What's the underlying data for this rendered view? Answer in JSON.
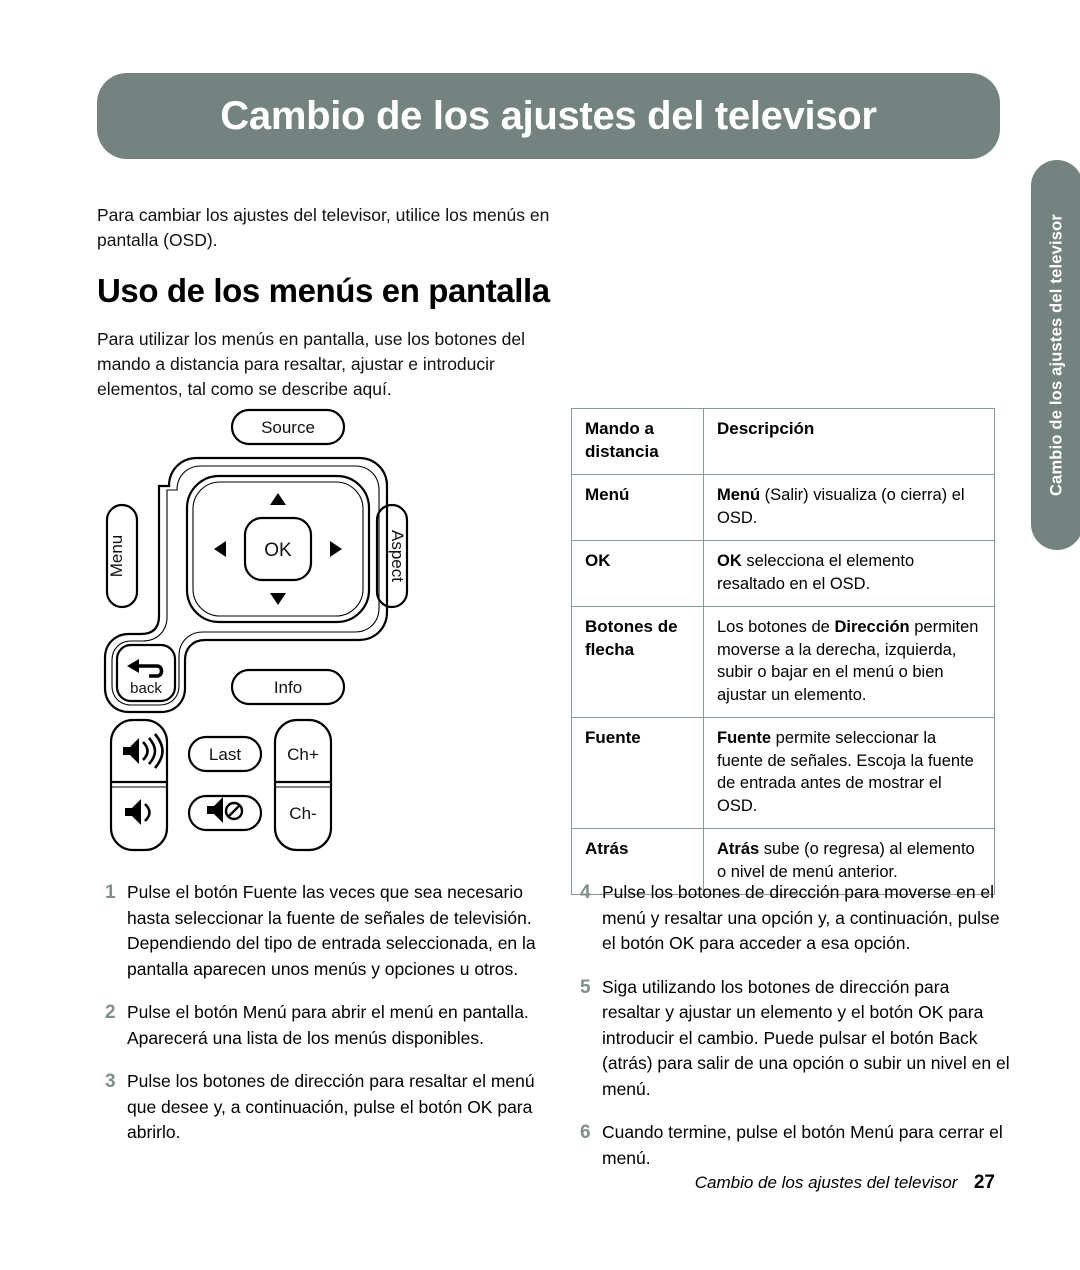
{
  "header": {
    "title": "Cambio de los ajustes del televisor"
  },
  "side_tab": {
    "label": "Cambio de los ajustes del televisor"
  },
  "intro": {
    "paragraph_1": "Para cambiar los ajustes del televisor, utilice los menús en pantalla (OSD).",
    "section_heading": "Uso de los menús en pantalla",
    "paragraph_2": "Para utilizar los menús en pantalla, use los botones del mando a distancia para resaltar, ajustar e introducir elementos, tal como se describe aquí."
  },
  "remote": {
    "source_label": "Source",
    "menu_label": "Menu",
    "aspect_label": "Aspect",
    "ok_label": "OK",
    "back_label": "back",
    "info_label": "Info",
    "last_label": "Last",
    "ch_up_label": "Ch+",
    "ch_down_label": "Ch-"
  },
  "table": {
    "headers": [
      "Mando a distancia",
      "Descripción"
    ],
    "header_key_line1": "Mando a",
    "header_key_line2": "distancia",
    "header_desc": "Descripción",
    "rows": [
      {
        "key": "Menú",
        "desc_bold": "Menú",
        "desc_rest": " (Salir) visualiza (o cierra) el OSD."
      },
      {
        "key": "OK",
        "desc_bold": "OK",
        "desc_rest": " selecciona el elemento resaltado en el OSD."
      },
      {
        "key": "Botones de flecha",
        "desc_pre": "Los botones de ",
        "desc_bold": "Dirección",
        "desc_rest": " permiten moverse a la derecha, izquierda, subir o bajar en el menú o bien ajustar un elemento."
      },
      {
        "key": "Fuente",
        "desc_bold": "Fuente",
        "desc_rest": " permite seleccionar la fuente de señales. Escoja la fuente de entrada antes de mostrar el OSD."
      },
      {
        "key": "Atrás",
        "desc_bold": "Atrás",
        "desc_rest": " sube (o regresa) al elemento o nivel de menú anterior."
      }
    ]
  },
  "steps_left": [
    {
      "num": "1",
      "text": "Pulse el botón Fuente las veces que sea necesario hasta seleccionar la fuente de señales de televisión. Dependiendo del tipo de entrada seleccionada, en la pantalla aparecen unos menús y opciones u otros."
    },
    {
      "num": "2",
      "text": "Pulse el botón Menú para abrir el menú en pantalla. Aparecerá una lista de los menús disponibles."
    },
    {
      "num": "3",
      "text": "Pulse los botones de dirección para resaltar el menú que desee y, a continuación, pulse el botón OK para abrirlo."
    }
  ],
  "steps_right": [
    {
      "num": "4",
      "text": "Pulse los botones de dirección para moverse en el menú y resaltar una opción y, a continuación, pulse el botón OK para acceder a esa opción."
    },
    {
      "num": "5",
      "text": "Siga utilizando los botones de dirección para resaltar y ajustar un elemento y el botón OK para introducir el cambio. Puede pulsar el botón Back (atrás) para salir de una opción o subir un nivel en el menú."
    },
    {
      "num": "6",
      "text": "Cuando termine, pulse el botón Menú para cerrar el menú."
    }
  ],
  "footer": {
    "title": "Cambio de los ajustes del televisor",
    "page": "27"
  },
  "colors": {
    "banner": "#74837f",
    "table_border": "#8a9a98",
    "step_number": "#7f8f8d"
  }
}
